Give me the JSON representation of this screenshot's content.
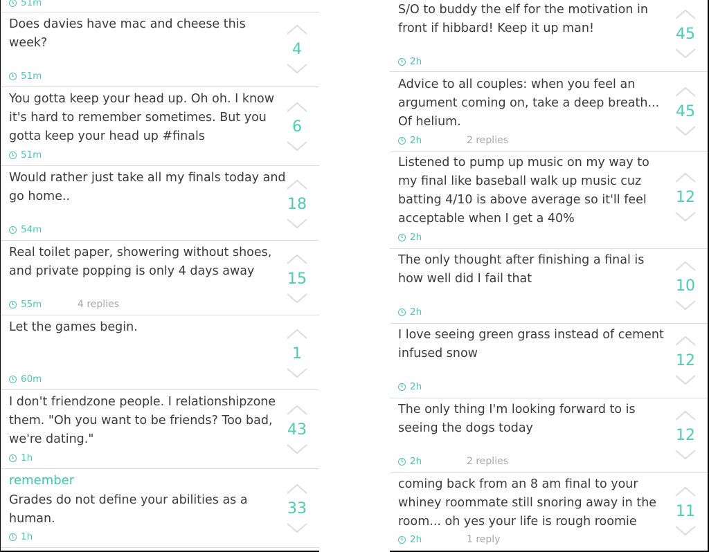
{
  "left_column": {
    "top_fragment_time": "51m",
    "posts": [
      {
        "text": "Does davies have mac and cheese this week?",
        "time": "51m",
        "replies": "",
        "score": "4"
      },
      {
        "text": "You gotta keep your head up. Oh oh. I know it's hard to remember sometimes. But you gotta keep your head up #finals",
        "time": "51m",
        "replies": "",
        "score": "6"
      },
      {
        "text": "Would rather just take all my finals today and go home..",
        "time": "54m",
        "replies": "",
        "score": "18"
      },
      {
        "text": "Real toilet paper, showering without shoes, and private popping is only 4 days away",
        "time": "55m",
        "replies": "4 replies",
        "score": "15"
      },
      {
        "text": "Let the games begin.",
        "time": "60m",
        "replies": "",
        "score": "1"
      },
      {
        "text": "I don't friendzone people. I relationshipzone them. \"Oh you want to be friends? Too bad, we're dating.\"",
        "time": "1h",
        "replies": "",
        "score": "43"
      },
      {
        "tag": "remember",
        "text": "Grades do not define your abilities as a human.",
        "time": "1h",
        "replies": "",
        "score": "33"
      }
    ]
  },
  "right_column": {
    "posts": [
      {
        "text": "S/O to buddy the elf for the motivation in front if hibbard! Keep it up man!",
        "time": "2h",
        "replies": "",
        "score": "45"
      },
      {
        "text": "Advice to all couples: when you feel an argument coming on, take a deep breath... Of helium.",
        "time": "2h",
        "replies": "2 replies",
        "score": "45"
      },
      {
        "text": "Listened to pump up music on my way to my final like baseball walk up music cuz batting 4/10 is above average so it'll feel acceptable when I get a 40%",
        "time": "2h",
        "replies": "",
        "score": "12"
      },
      {
        "text": "The only thought after finishing a final is how well did I fail that",
        "time": "2h",
        "replies": "",
        "score": "10"
      },
      {
        "text": "I love seeing green grass instead of cement infused snow",
        "time": "2h",
        "replies": "",
        "score": "12"
      },
      {
        "text": "The only thing I'm looking forward to is seeing the dogs today",
        "time": "2h",
        "replies": "2 replies",
        "score": "12"
      },
      {
        "text": "coming back from an 8 am final to your whiney roommate still snoring away in the room... oh yes your life is rough roomie",
        "time": "2h",
        "replies": "1 reply",
        "score": "11"
      }
    ]
  },
  "icons": {
    "clock": "clock-icon",
    "upvote": "chevron-up-icon",
    "downvote": "chevron-down-icon"
  },
  "colors": {
    "accent": "#4ecbb5",
    "text": "#3b3b3b",
    "muted": "#a7a7a7",
    "divider": "#dcdcdc"
  }
}
